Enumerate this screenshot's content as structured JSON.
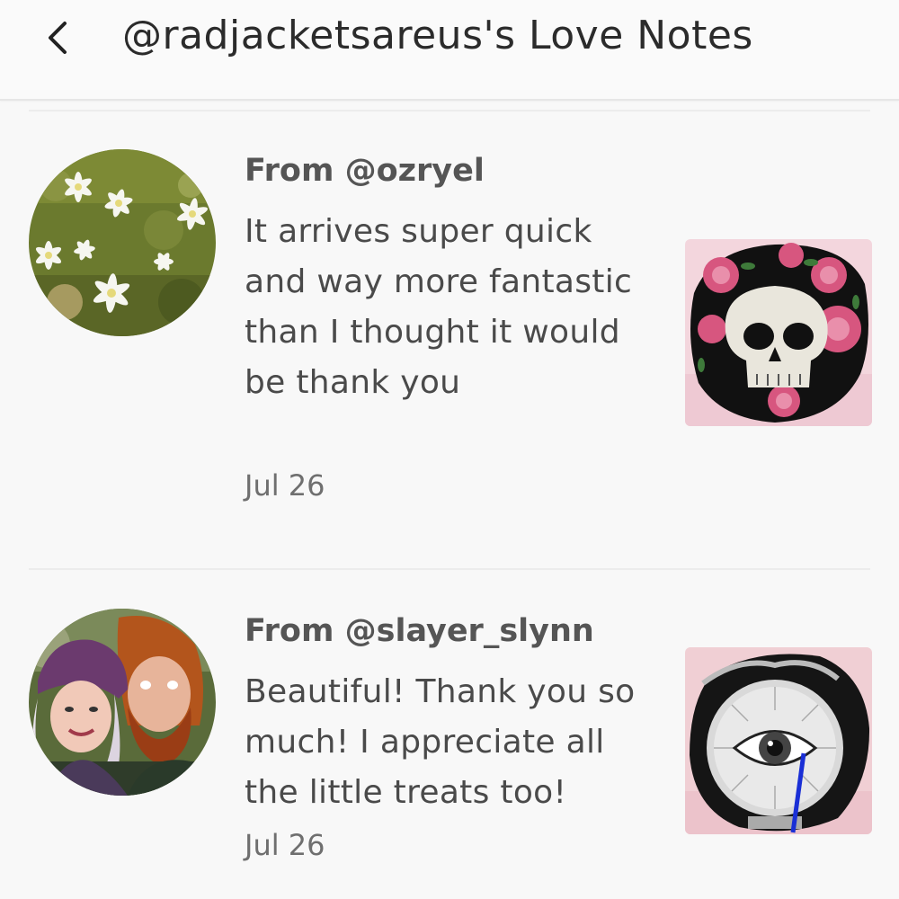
{
  "header": {
    "title": "@radjacketsareus's Love Notes",
    "back_icon": "chevron-left-icon"
  },
  "notes": [
    {
      "from": "From @ozryel",
      "message": "It arrives super quick and way more fantastic than I thought it would be thank you",
      "date": "Jul 26",
      "avatar": "flowers-photo",
      "product": "skull-roses-patch-photo"
    },
    {
      "from": "From @slayer_slynn",
      "message": "Beautiful! Thank you so much! I appreciate all the little treats too!",
      "date": "Jul 26",
      "avatar": "couple-photo",
      "product": "eye-crystal-ball-patch-photo"
    }
  ],
  "colors": {
    "background": "#f8f8f8",
    "title": "#2b2b2b",
    "from": "#555555",
    "message": "#4a4a4a",
    "date": "#6f6f6f"
  }
}
